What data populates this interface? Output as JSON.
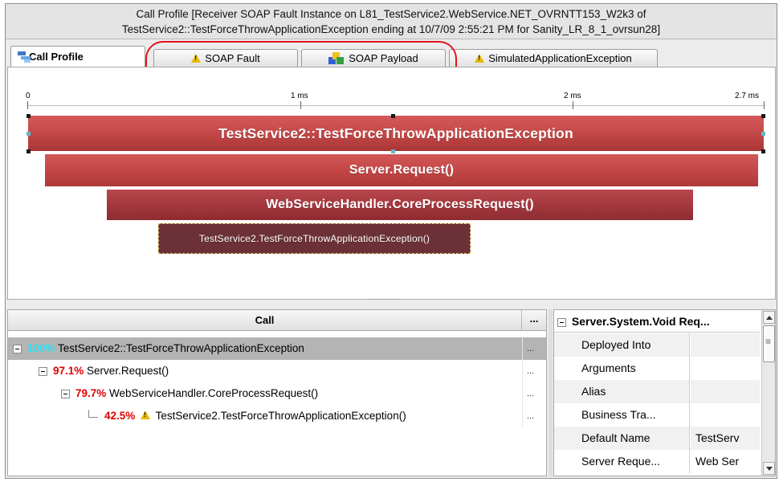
{
  "header": {
    "line1": "Call Profile [Receiver SOAP Fault Instance on L81_TestService2.WebService.NET_OVRNTT153_W2k3 of",
    "line2": "TestService2::TestForceThrowApplicationException ending at 10/7/09 2:55:21 PM for Sanity_LR_8_1_ovrsun28]"
  },
  "tabs": [
    {
      "label": "Call Profile",
      "icon": "call-profile-icon",
      "active": true
    },
    {
      "label": "SOAP Fault",
      "icon": "warning-icon"
    },
    {
      "label": "SOAP Payload",
      "icon": "payload-icon"
    },
    {
      "label": "SimulatedApplicationException",
      "icon": "warning-icon"
    }
  ],
  "timeline": {
    "ticks": [
      "0",
      "1 ms",
      "2 ms",
      "2.7 ms"
    ],
    "bars": [
      {
        "label": "TestService2::TestForceThrowApplicationException"
      },
      {
        "label": "Server.Request()"
      },
      {
        "label": "WebServiceHandler.CoreProcessRequest()"
      },
      {
        "label": "TestService2.TestForceThrowApplicationException()"
      }
    ]
  },
  "calltree": {
    "header_call": "Call",
    "header_more": "...",
    "rows": [
      {
        "pct": "100%",
        "label": "TestService2::TestForceThrowApplicationException",
        "dots": "..."
      },
      {
        "pct": "97.1%",
        "label": "Server.Request()",
        "dots": "..."
      },
      {
        "pct": "79.7%",
        "label": "WebServiceHandler.CoreProcessRequest()",
        "dots": "..."
      },
      {
        "pct": "42.5%",
        "label": "TestService2.TestForceThrowApplicationException()",
        "dots": "..."
      }
    ]
  },
  "properties": {
    "title": "Server.System.Void Req...",
    "rows": [
      {
        "key": "Deployed Into",
        "value": ""
      },
      {
        "key": "Arguments",
        "value": ""
      },
      {
        "key": "Alias",
        "value": ""
      },
      {
        "key": "Business Tra...",
        "value": ""
      },
      {
        "key": "Default Name",
        "value": "TestServ"
      },
      {
        "key": "Server Reque...",
        "value": "Web Ser"
      }
    ]
  },
  "colors": {
    "highlight": "#e0141e",
    "percent_red": "#e00000",
    "percent_cyan": "#2de0f0",
    "bar_primary": "#c24646",
    "bar_dark": "#6c3038"
  }
}
